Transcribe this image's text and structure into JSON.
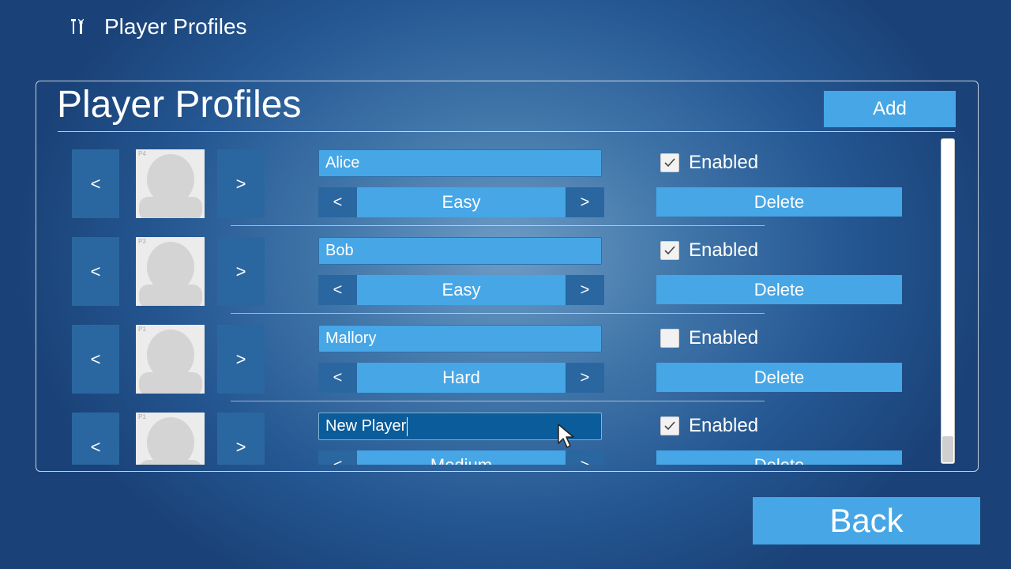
{
  "window": {
    "title": "Player Profiles",
    "icon": "tools-icon"
  },
  "panel": {
    "title": "Player Profiles",
    "add_label": "Add"
  },
  "profiles": [
    {
      "slot_tag": "P4",
      "prev": "<",
      "next": ">",
      "name": "Alice",
      "difficulty": "Easy",
      "enabled": true,
      "enabled_label": "Enabled",
      "delete_label": "Delete"
    },
    {
      "slot_tag": "P3",
      "prev": "<",
      "next": ">",
      "name": "Bob",
      "difficulty": "Easy",
      "enabled": true,
      "enabled_label": "Enabled",
      "delete_label": "Delete"
    },
    {
      "slot_tag": "P1",
      "prev": "<",
      "next": ">",
      "name": "Mallory",
      "difficulty": "Hard",
      "enabled": false,
      "enabled_label": "Enabled",
      "delete_label": "Delete"
    },
    {
      "slot_tag": "P1",
      "prev": "<",
      "next": ">",
      "name": "New Player",
      "difficulty": "Medium",
      "enabled": true,
      "enabled_label": "Enabled",
      "delete_label": "Delete",
      "focused": true
    }
  ],
  "difficulty_arrows": {
    "prev": "<",
    "next": ">"
  },
  "back_label": "Back",
  "colors": {
    "button": "#46a6e6",
    "arrow": "#2a67a0",
    "focused_input": "#0a5c9a"
  }
}
